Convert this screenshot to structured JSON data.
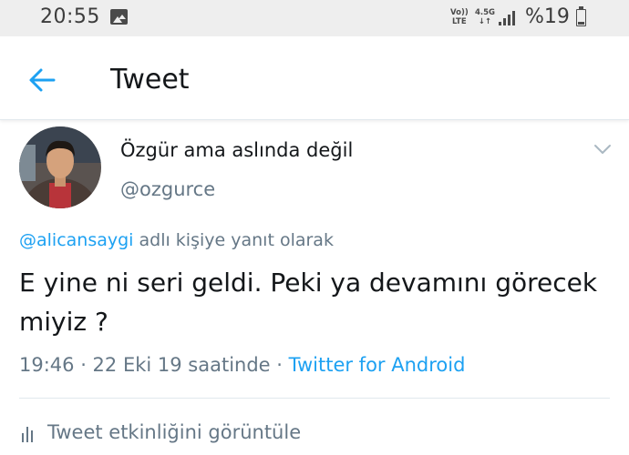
{
  "status_bar": {
    "time": "20:55",
    "volte_top": "Vo))",
    "volte_bottom": "LTE",
    "network_top": "4.5G",
    "network_bottom": "↓↑",
    "battery": "%19"
  },
  "header": {
    "title": "Tweet"
  },
  "tweet": {
    "display_name": "Özgür ama aslında değil",
    "handle": "@ozgurce",
    "reply_mention": "@alicansaygi",
    "reply_suffix": " adlı kişiye yanıt olarak",
    "text": "E yine ni seri geldi. Peki ya devamını görecek miyiz ?",
    "time_date": "19:46 · 22 Eki 19 saatinde · ",
    "source": "Twitter for Android",
    "activity_label": "Tweet etkinliğini görüntüle"
  },
  "colors": {
    "accent": "#1da1f2",
    "text_primary": "#14171a",
    "text_secondary": "#657786",
    "status_bar_bg": "#eeeeee",
    "divider": "#e1e8ed"
  }
}
